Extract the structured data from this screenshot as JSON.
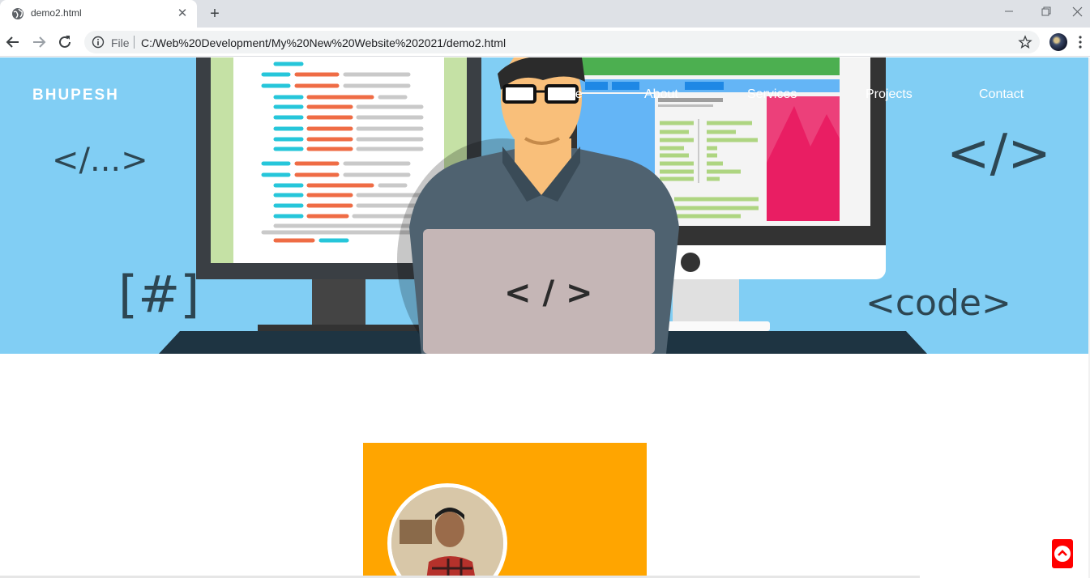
{
  "browser": {
    "tab_title": "demo2.html",
    "tab_close": "✕",
    "new_tab": "+",
    "omnibox_file_label": "File",
    "url": "C:/Web%20Development/My%20New%20Website%202021/demo2.html"
  },
  "header": {
    "brand": "BHUPESH",
    "nav": [
      {
        "label": "Home"
      },
      {
        "label": "About"
      },
      {
        "label": "Services"
      },
      {
        "label": "Projects"
      },
      {
        "label": "Contact"
      }
    ]
  },
  "hero": {
    "symbols": [
      "</...>",
      "</>",
      "[#]",
      "<code>",
      "< / >"
    ],
    "background_color": "#81cef4"
  },
  "card": {
    "background_color": "#ffa500"
  },
  "scroll_top": {
    "icon": "chevron-up-icon",
    "color": "#ff0000"
  }
}
